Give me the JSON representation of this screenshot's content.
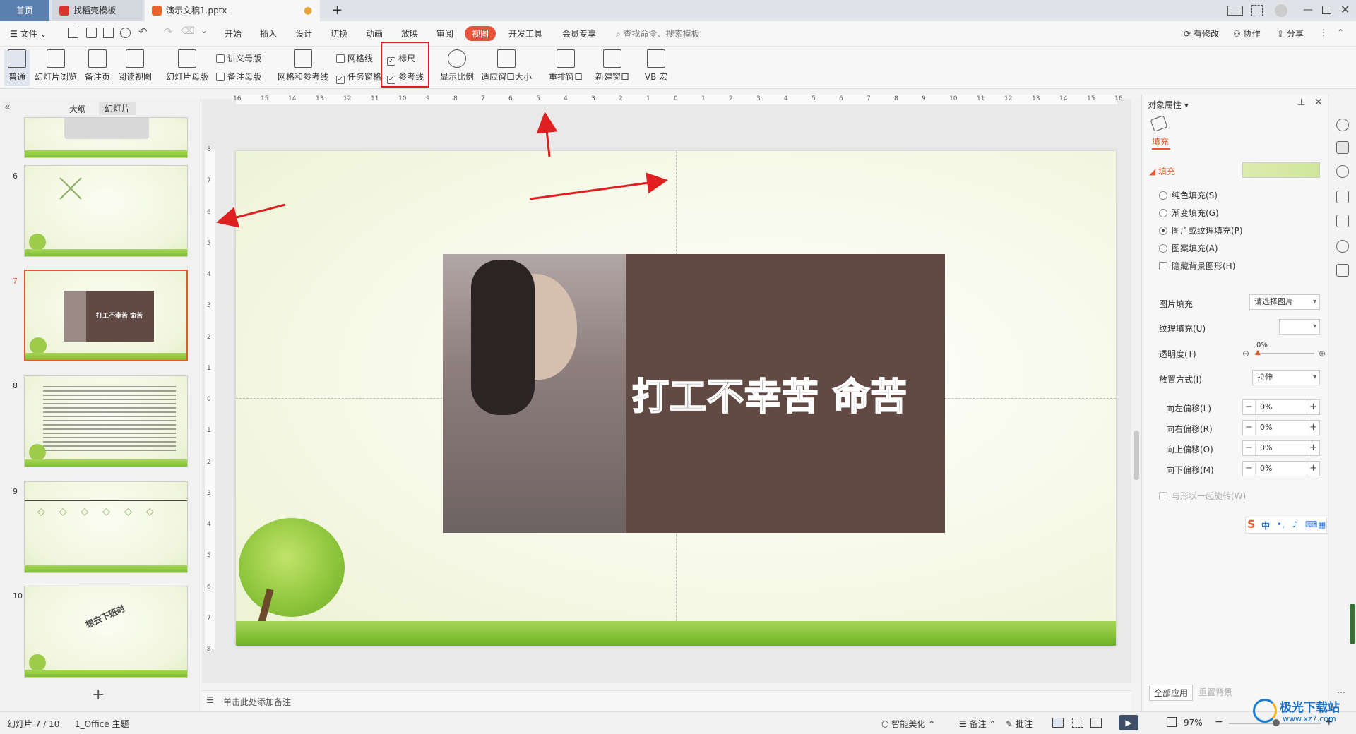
{
  "tabs": {
    "home": "首页",
    "template": "找稻壳模板",
    "document": "演示文稿1.pptx",
    "add": "+"
  },
  "menu": {
    "file": "文件",
    "items": [
      "开始",
      "插入",
      "设计",
      "切换",
      "动画",
      "放映",
      "审阅",
      "视图",
      "开发工具",
      "会员专享"
    ],
    "active": "视图",
    "search_placeholder": "查找命令、搜索模板",
    "has_changes": "有修改",
    "collaborate": "协作",
    "share": "分享"
  },
  "ribbon": {
    "normal": "普通",
    "slide_browse": "幻灯片浏览",
    "notes_page": "备注页",
    "reading_view": "阅读视图",
    "slide_master": "幻灯片母版",
    "handout_master": "讲义母版",
    "notes_master": "备注母版",
    "grid_guides": "网格和参考线",
    "gridlines": "网格线",
    "taskpane": "任务窗格",
    "ruler": "标尺",
    "guides": "参考线",
    "zoom": "显示比例",
    "fit_window": "适应窗口大小",
    "rearrange": "重排窗口",
    "new_window": "新建窗口",
    "vb_macro": "VB 宏"
  },
  "left_panel": {
    "outline": "大纲",
    "slides": "幻灯片",
    "slide_numbers": [
      "6",
      "7",
      "8",
      "9",
      "10"
    ],
    "slide7_text": "打工不幸苦 命苦",
    "slide10_text": "想去下班时",
    "add": "+"
  },
  "slide": {
    "text": "打工不幸苦 命苦",
    "box_color": "#614a44"
  },
  "ruler": {
    "h_labels": [
      "16",
      "15",
      "14",
      "13",
      "12",
      "11",
      "10",
      "9",
      "8",
      "7",
      "6",
      "5",
      "4",
      "3",
      "2",
      "1",
      "0",
      "1",
      "2",
      "3",
      "4",
      "5",
      "6",
      "7",
      "8",
      "9",
      "10",
      "11",
      "12",
      "13",
      "14",
      "15",
      "16"
    ],
    "v_labels": [
      "8",
      "7",
      "6",
      "5",
      "4",
      "3",
      "2",
      "1",
      "0",
      "1",
      "2",
      "3",
      "4",
      "5",
      "6",
      "7",
      "8"
    ]
  },
  "notes": {
    "placeholder": "单击此处添加备注"
  },
  "right_panel": {
    "title": "对象属性",
    "tab": "填充",
    "section": "填充",
    "options": [
      "纯色填充(S)",
      "渐变填充(G)",
      "图片或纹理填充(P)",
      "图案填充(A)"
    ],
    "selected_option": "图片或纹理填充(P)",
    "hide_bg": "隐藏背景图形(H)",
    "picture_fill_label": "图片填充",
    "picture_fill_value": "请选择图片",
    "texture_fill_label": "纹理填充(U)",
    "transparency_label": "透明度(T)",
    "transparency_value": "0%",
    "placement_label": "放置方式(I)",
    "placement_value": "拉伸",
    "offsets": [
      {
        "label": "向左偏移(L)",
        "value": "0%"
      },
      {
        "label": "向右偏移(R)",
        "value": "0%"
      },
      {
        "label": "向上偏移(O)",
        "value": "0%"
      },
      {
        "label": "向下偏移(M)",
        "value": "0%"
      }
    ],
    "rotate_with_shape": "与形状一起旋转(W)",
    "apply_all": "全部应用",
    "reset_bg": "重置背景"
  },
  "ime": {
    "lang": "中",
    "punct": "•,"
  },
  "status": {
    "slide_pos": "幻灯片 7 / 10",
    "theme": "1_Office 主题",
    "smart_beautify": "智能美化",
    "notes": "备注",
    "comments": "批注",
    "zoom": "97%"
  },
  "watermark": {
    "site": "极光下载站",
    "url": "www.xz7.com"
  },
  "colors": {
    "accent": "#e35b2c",
    "active_tab": "#e8513a",
    "annotation": "#e02020"
  }
}
